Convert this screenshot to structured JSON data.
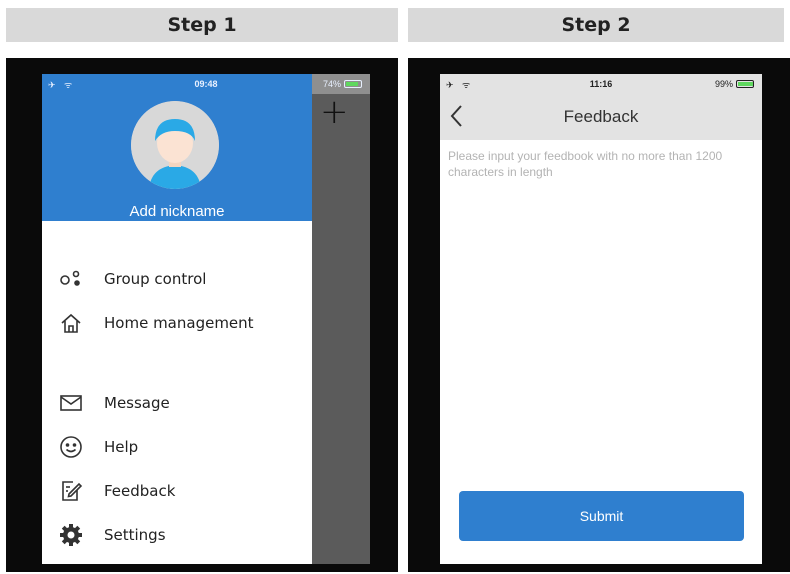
{
  "step1": {
    "header": "Step 1",
    "status_bar": {
      "left": "✈ ᯤ",
      "time": "09:48",
      "battery": "74%"
    },
    "plus_icon": "plus-icon",
    "nickname": "Add nickname",
    "menu": [
      {
        "label": "Group control",
        "icon": "group-control-icon"
      },
      {
        "label": "Home management",
        "icon": "home-icon"
      },
      {
        "label": "Message",
        "icon": "envelope-icon"
      },
      {
        "label": "Help",
        "icon": "smiley-icon"
      },
      {
        "label": "Feedback",
        "icon": "feedback-icon"
      },
      {
        "label": "Settings",
        "icon": "gear-icon"
      }
    ]
  },
  "step2": {
    "header": "Step 2",
    "status_bar": {
      "left": "✈ ᯤ",
      "time": "11:16",
      "battery": "99%"
    },
    "title": "Feedback",
    "placeholder": "Please input your feedbook with no more than 1200 characters in length",
    "submit_label": "Submit"
  },
  "colors": {
    "header_bg": "#d9d9d9",
    "accent": "#2f7fcf",
    "overlay": "#5b5b5b",
    "frame": "#0a0a0a"
  }
}
